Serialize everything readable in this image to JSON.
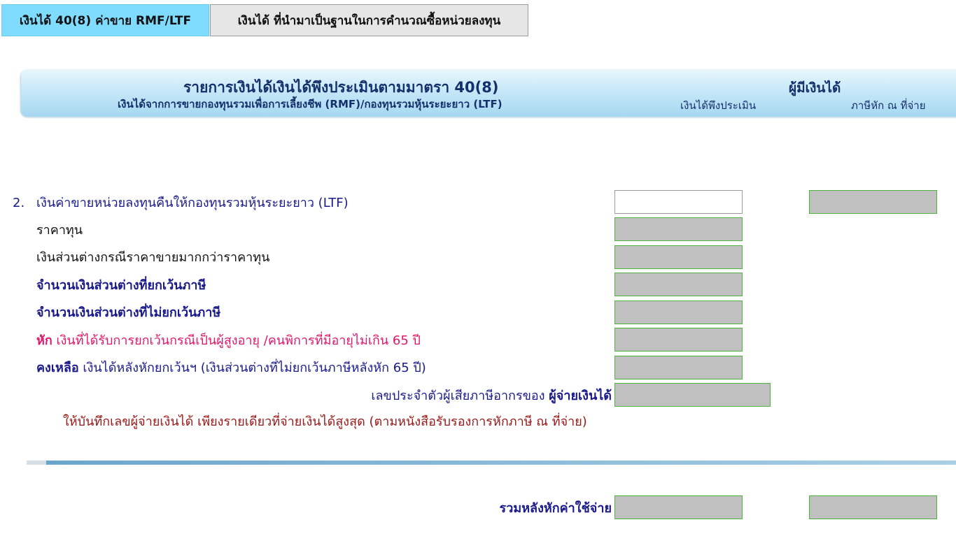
{
  "tabs": [
    {
      "label": "เงินได้ 40(8) ค่าขาย RMF/LTF",
      "active": true
    },
    {
      "label": "เงินได้ ที่นำมาเป็นฐานในการคำนวณซื้อหน่วยลงทุน",
      "active": false
    }
  ],
  "header": {
    "title": "รายการเงินได้เงินได้พึงประเมินตามมาตรา 40(8)",
    "subtitle": "เงินได้จากการขายกองทุนรวมเพื่อการเลี้ยงชีพ (RMF)/กองทุนรวมหุ้นระยะยาว (LTF)",
    "right_title": "ผู้มีเงินได้",
    "col_assessable": "เงินได้พึงประเมิน",
    "col_withholding": "ภาษีหัก ณ ที่จ่าย"
  },
  "rows": {
    "item_number": "2.",
    "item_label": "เงินค่าขายหน่วยลงทุนคืนให้กองทุนรวมหุ้นระยะยาว (LTF)",
    "cost": "ราคาทุน",
    "diff": "เงินส่วนต่างกรณีราคาขายมากกว่าราคาทุน",
    "exempt": "จำนวนเงินส่วนต่างที่ยกเว้นภาษี",
    "non_exempt": "จำนวนเงินส่วนต่างที่ไม่ยกเว้นภาษี",
    "deduct_prefix": "หัก",
    "deduct_text": " เงินที่ได้รับการยกเว้นกรณีเป็นผู้สูงอายุ /คนพิการที่มีอายุไม่เกิน 65 ปี",
    "remain_prefix": "คงเหลือ",
    "remain_text": " เงินได้หลังหักยกเว้นฯ (เงินส่วนต่างที่ไม่ยกเว้นภาษีหลังหัก 65 ปี)",
    "payer_id_label": "เลขประจำตัวผู้เสียภาษีอากรของ ",
    "payer_id_bold": "ผู้จ่ายเงินได้",
    "note": "ให้บันทึกเลขผู้จ่ายเงินได้ เพียงรายเดียวที่จ่ายเงินได้สูงสุด (ตามหนังสือรับรองการหักภาษี ณ ที่จ่าย)",
    "total_label": "รวมหลังหักค่าใช้จ่าย"
  },
  "fields": {
    "ltf_amount": "",
    "ltf_tax": "",
    "cost": "",
    "diff": "",
    "exempt": "",
    "non_exempt": "",
    "deduct": "",
    "remain": "",
    "payer_id": "",
    "total_amount": "",
    "total_tax": ""
  },
  "colors": {
    "tab_active": "#7fdcff",
    "label_navy": "#1a1a8c",
    "label_pink": "#e0186c",
    "note_maroon": "#9b1616",
    "field_disabled": "#c0c0c0",
    "field_border": "#4fb43f"
  }
}
